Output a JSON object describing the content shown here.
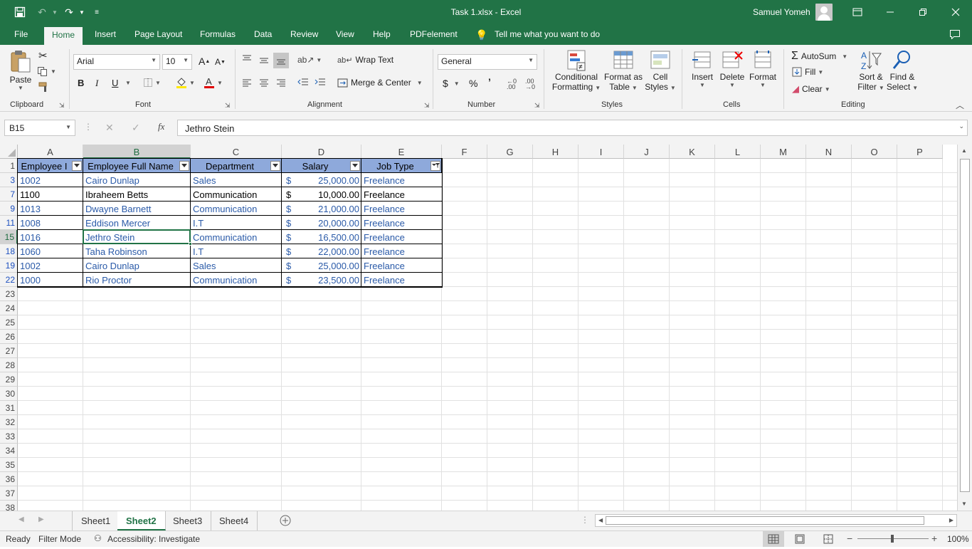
{
  "app": {
    "title": "Task 1.xlsx  -  Excel",
    "user": "Samuel Yomeh",
    "accent": "#217346"
  },
  "menu_tabs": [
    "File",
    "Home",
    "Insert",
    "Page Layout",
    "Formulas",
    "Data",
    "Review",
    "View",
    "Help",
    "PDFelement"
  ],
  "tell_me": "Tell me what you want to do",
  "ribbon": {
    "clipboard": {
      "label": "Clipboard",
      "paste": "Paste"
    },
    "font": {
      "label": "Font",
      "name": "Arial",
      "size": "10",
      "bold": "B",
      "italic": "I",
      "underline": "U"
    },
    "alignment": {
      "label": "Alignment",
      "wrap_text": "Wrap Text",
      "merge_center": "Merge & Center"
    },
    "number": {
      "label": "Number",
      "format": "General",
      "currency": "$",
      "percent": "%",
      "comma": "’"
    },
    "styles": {
      "label": "Styles",
      "conditional": "Conditional",
      "formatting": "Formatting",
      "format_as": "Format as",
      "table": "Table",
      "cell": "Cell",
      "styles": "Styles"
    },
    "cells": {
      "label": "Cells",
      "insert": "Insert",
      "delete": "Delete",
      "format": "Format"
    },
    "editing": {
      "label": "Editing",
      "autosum": "AutoSum",
      "fill": "Fill",
      "clear": "Clear",
      "sort": "Sort &",
      "filter": "Filter",
      "find": "Find &",
      "select": "Select"
    }
  },
  "formula_bar": {
    "name_box": "B15",
    "fx": "fx",
    "content": "Jethro Stein"
  },
  "columns": [
    "A",
    "B",
    "C",
    "D",
    "E",
    "F",
    "G",
    "H",
    "I",
    "J",
    "K",
    "L",
    "M",
    "N",
    "O",
    "P"
  ],
  "rows": [
    "1",
    "3",
    "7",
    "9",
    "11",
    "15",
    "18",
    "19",
    "22",
    "23",
    "24",
    "25",
    "26",
    "27",
    "28",
    "29",
    "30",
    "31",
    "32",
    "33",
    "34",
    "35",
    "36",
    "37",
    "38"
  ],
  "table": {
    "headers": [
      "Employee I",
      "Employee Full Name",
      "Department",
      "Salary",
      "Job Type"
    ],
    "data": [
      {
        "id": "1002",
        "name": "Cairo Dunlap",
        "dept": "Sales",
        "cur": "$",
        "salary": "25,000.00",
        "type": "Freelance",
        "black": false
      },
      {
        "id": "1100",
        "name": "Ibraheem Betts",
        "dept": "Communication",
        "cur": "$",
        "salary": "10,000.00",
        "type": "Freelance",
        "black": true
      },
      {
        "id": "1013",
        "name": "Dwayne Barnett",
        "dept": "Communication",
        "cur": "$",
        "salary": "21,000.00",
        "type": "Freelance",
        "black": false
      },
      {
        "id": "1008",
        "name": "Eddison Mercer",
        "dept": "I.T",
        "cur": "$",
        "salary": "20,000.00",
        "type": "Freelance",
        "black": false
      },
      {
        "id": "1016",
        "name": "Jethro Stein",
        "dept": "Communication",
        "cur": "$",
        "salary": "16,500.00",
        "type": "Freelance",
        "black": false
      },
      {
        "id": "1060",
        "name": "Taha Robinson",
        "dept": "I.T",
        "cur": "$",
        "salary": "22,000.00",
        "type": "Freelance",
        "black": false
      },
      {
        "id": "1002",
        "name": "Cairo Dunlap",
        "dept": "Sales",
        "cur": "$",
        "salary": "25,000.00",
        "type": "Freelance",
        "black": false
      },
      {
        "id": "1000",
        "name": "Rio Proctor",
        "dept": "Communication",
        "cur": "$",
        "salary": "23,500.00",
        "type": "Freelance",
        "black": false
      }
    ]
  },
  "sheets": [
    "Sheet1",
    "Sheet2",
    "Sheet3",
    "Sheet4"
  ],
  "active_sheet": "Sheet2",
  "status": {
    "ready": "Ready",
    "filter_mode": "Filter Mode",
    "accessibility": "Accessibility: Investigate",
    "zoom": "100%"
  }
}
